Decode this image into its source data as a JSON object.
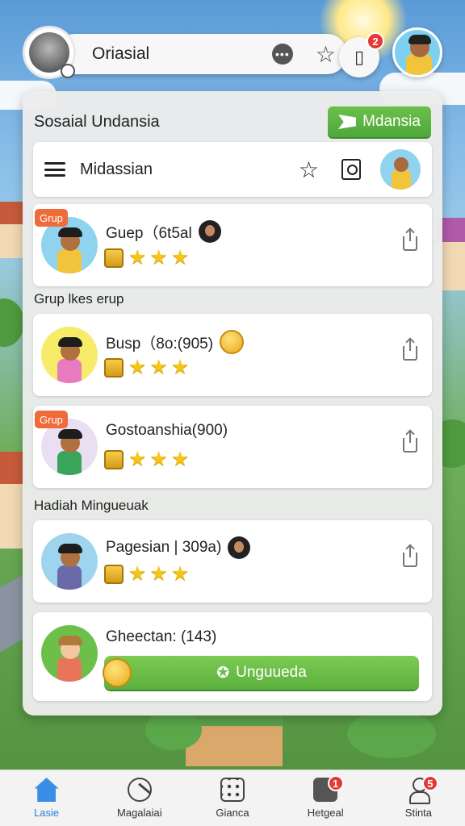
{
  "header": {
    "title": "Oriasial",
    "book_badge": "2"
  },
  "panel": {
    "title": "Sosaial Undansia",
    "action_label": "Mdansia",
    "subbar_title": "Midassian"
  },
  "sections": {
    "first": "Grup lkes erup",
    "second": "Hadiah Minguеuak"
  },
  "cards": [
    {
      "tag": "Grup",
      "name": "Guep（6t5al",
      "stars": 3
    },
    {
      "tag": "",
      "name": "Busp（8o:(905)",
      "stars": 3
    },
    {
      "tag": "Grup",
      "name": "Gostoanshia(900)",
      "stars": 3
    },
    {
      "tag": "",
      "name": "Pagesian | 309a)",
      "stars": 3
    },
    {
      "tag": "",
      "name": "Gheectan: (143)",
      "action_label": "Unguueda"
    }
  ],
  "bottom_nav": [
    {
      "label": "Lasie",
      "active": true
    },
    {
      "label": "Magalaiai",
      "active": false
    },
    {
      "label": "Gianca",
      "active": false
    },
    {
      "label": "Hetgeal",
      "active": false,
      "badge": "1"
    },
    {
      "label": "Stinta",
      "active": false,
      "badge": "5"
    }
  ],
  "colors": {
    "accent_green": "#5bb03c",
    "tag_orange": "#ef6c3a",
    "badge_red": "#e53935",
    "active_blue": "#2d7fd8",
    "star_gold": "#f5c51c"
  },
  "icons": [
    "star-icon",
    "more-icon",
    "book-icon",
    "menu-icon",
    "document-icon",
    "share-icon",
    "coin-icon",
    "home-icon",
    "tag-icon",
    "grid-icon",
    "chat-icon",
    "person-icon",
    "flag-icon"
  ]
}
